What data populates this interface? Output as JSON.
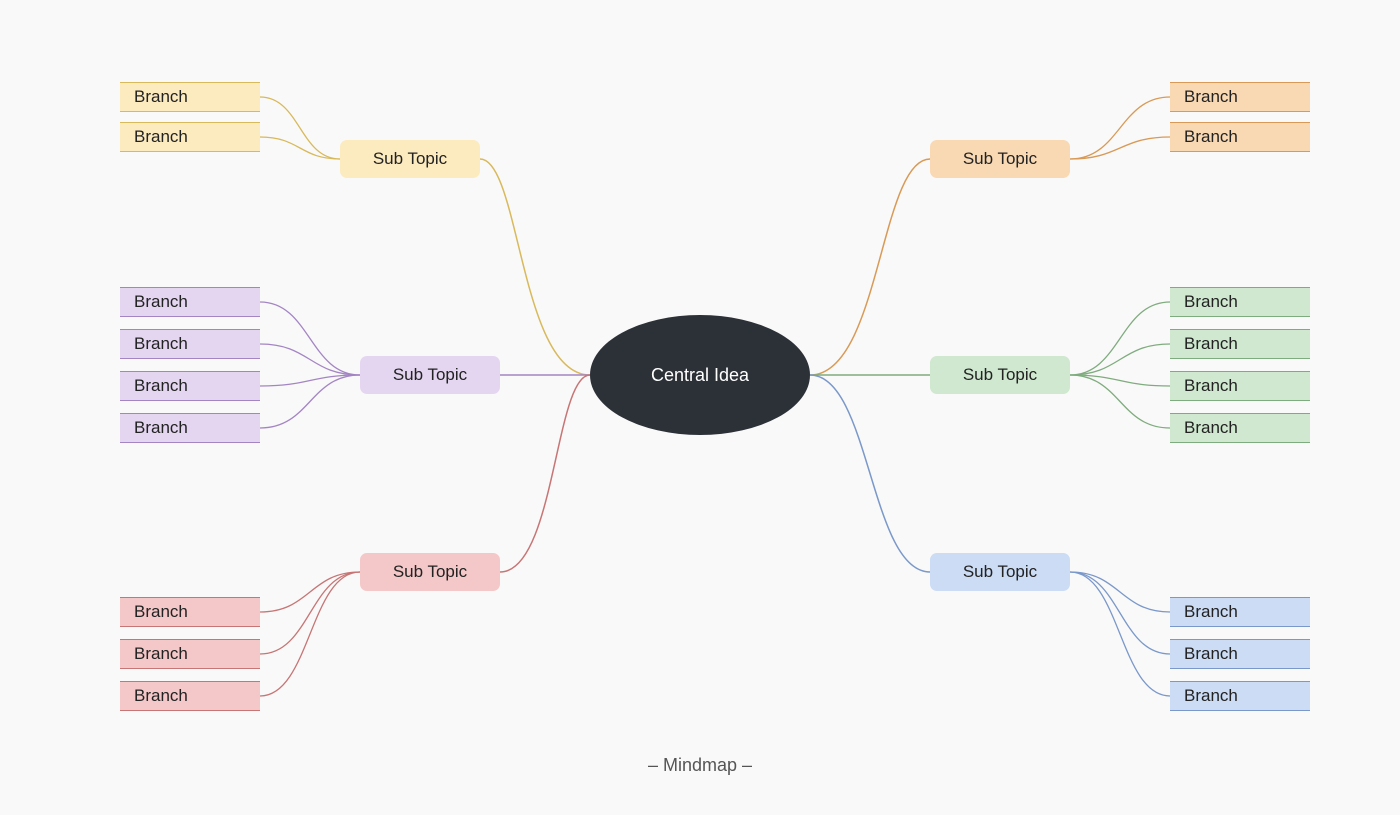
{
  "caption": "– Mindmap –",
  "central": {
    "label": "Central Idea"
  },
  "subtopics": {
    "tl": {
      "label": "Sub Topic",
      "color": "yellow",
      "stroke": "#d8b95b",
      "branches": [
        "Branch",
        "Branch"
      ]
    },
    "ml": {
      "label": "Sub Topic",
      "color": "purple",
      "stroke": "#a485c3",
      "branches": [
        "Branch",
        "Branch",
        "Branch",
        "Branch"
      ]
    },
    "bl": {
      "label": "Sub Topic",
      "color": "pink",
      "stroke": "#c77575",
      "branches": [
        "Branch",
        "Branch",
        "Branch"
      ]
    },
    "tr": {
      "label": "Sub Topic",
      "color": "orange",
      "stroke": "#d89a56",
      "branches": [
        "Branch",
        "Branch"
      ]
    },
    "mr": {
      "label": "Sub Topic",
      "color": "green",
      "stroke": "#7fac7e",
      "branches": [
        "Branch",
        "Branch",
        "Branch",
        "Branch"
      ]
    },
    "br": {
      "label": "Sub Topic",
      "color": "blue",
      "stroke": "#7a98c9",
      "branches": [
        "Branch",
        "Branch",
        "Branch"
      ]
    }
  }
}
